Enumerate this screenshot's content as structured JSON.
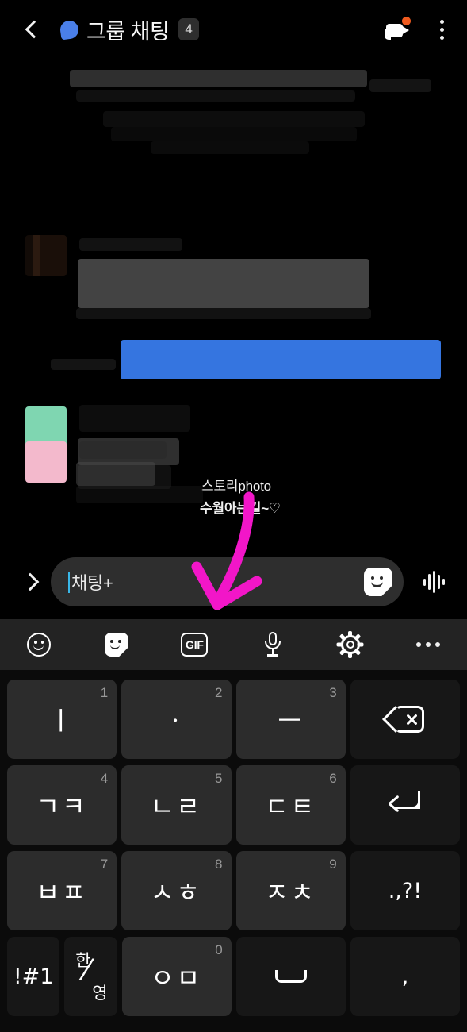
{
  "header": {
    "back_icon": "chevron-left-icon",
    "chat_icon": "chat-bubble-icon",
    "title": "그룹 채팅",
    "member_count": "4",
    "video_icon": "video-call-icon",
    "menu_icon": "overflow-menu-icon",
    "badge_color": "#ef5a1e",
    "accent_color": "#4a7fe8"
  },
  "conversation": {
    "blue_bubble_color": "#3575e0",
    "gray_bubble_color": "#4c4c4c",
    "story_caption": "스토리photo",
    "story_subtitle": "수월아는길~♡"
  },
  "annotation": {
    "arrow_color": "#f216c8",
    "points_to": "gif-button"
  },
  "input_bar": {
    "expand_icon": "chevron-right-icon",
    "placeholder": "채팅+",
    "caret_color": "#39b7e8",
    "sticker_icon": "sticker-icon",
    "voice_icon": "voice-waveform-icon"
  },
  "keyboard_toolbar": {
    "items": [
      {
        "name": "emoji-button",
        "icon": "emoji-smiley-icon",
        "label": ""
      },
      {
        "name": "sticker-button",
        "icon": "sticker-icon",
        "label": ""
      },
      {
        "name": "gif-button",
        "icon": "gif-icon",
        "label": "GIF"
      },
      {
        "name": "voice-input-button",
        "icon": "microphone-icon",
        "label": ""
      },
      {
        "name": "settings-button",
        "icon": "gear-icon",
        "label": ""
      },
      {
        "name": "more-button",
        "icon": "ellipsis-icon",
        "label": ""
      }
    ]
  },
  "keyboard": {
    "background": "#0b0b0b",
    "key_color": "#2c2c2c",
    "function_key_color": "#171717",
    "rows": [
      [
        {
          "name": "key-i",
          "glyph": "ㅣ",
          "num": "1",
          "type": "char"
        },
        {
          "name": "key-dot",
          "glyph": "ㆍ",
          "num": "2",
          "type": "char"
        },
        {
          "name": "key-eu",
          "glyph": "ㅡ",
          "num": "3",
          "type": "char"
        },
        {
          "name": "key-backspace",
          "glyph": "",
          "num": "",
          "type": "backspace"
        }
      ],
      [
        {
          "name": "key-giyeok-kieuk",
          "glyph": "ㄱㅋ",
          "num": "4",
          "type": "char"
        },
        {
          "name": "key-nieun-rieul",
          "glyph": "ㄴㄹ",
          "num": "5",
          "type": "char"
        },
        {
          "name": "key-digeut-tieut",
          "glyph": "ㄷㅌ",
          "num": "6",
          "type": "char"
        },
        {
          "name": "key-enter",
          "glyph": "",
          "num": "",
          "type": "enter"
        }
      ],
      [
        {
          "name": "key-bieup-pieup",
          "glyph": "ㅂㅍ",
          "num": "7",
          "type": "char"
        },
        {
          "name": "key-siot-hieut",
          "glyph": "ㅅㅎ",
          "num": "8",
          "type": "char"
        },
        {
          "name": "key-jieut-chieut",
          "glyph": "ㅈㅊ",
          "num": "9",
          "type": "char"
        },
        {
          "name": "key-punctuation",
          "glyph": ".,?!",
          "num": "",
          "type": "punct"
        }
      ],
      [
        {
          "name": "key-symbols",
          "glyph": "!#1",
          "num": "",
          "type": "sym"
        },
        {
          "name": "key-language-toggle",
          "glyph": "한/영",
          "ko": "한",
          "en": "영",
          "num": "",
          "type": "lang"
        },
        {
          "name": "key-ieung-mieum",
          "glyph": "ㅇㅁ",
          "num": "0",
          "type": "char"
        },
        {
          "name": "key-space",
          "glyph": "",
          "num": "",
          "type": "space"
        },
        {
          "name": "key-comma",
          "glyph": ",",
          "num": "",
          "type": "comma"
        }
      ]
    ]
  }
}
